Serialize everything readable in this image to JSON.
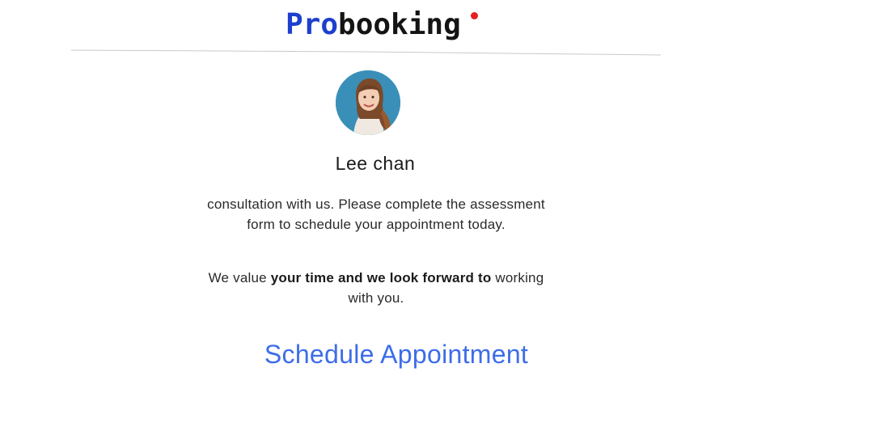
{
  "brand": {
    "pro": "Pro",
    "rest": "booking",
    "pro_color": "#1d3fcf",
    "dot_color": "#e62020"
  },
  "profile": {
    "name": "Lee chan",
    "avatar_icon": "profile-photo"
  },
  "message": {
    "line1": "consultation with us. Please complete the assessment form to schedule your appointment today.",
    "line2_prefix": "We value ",
    "line2_bold": "your time and we look forward to",
    "line2_suffix": " working with you."
  },
  "cta": {
    "label": "Schedule Appointment",
    "color": "#3d6de8"
  }
}
